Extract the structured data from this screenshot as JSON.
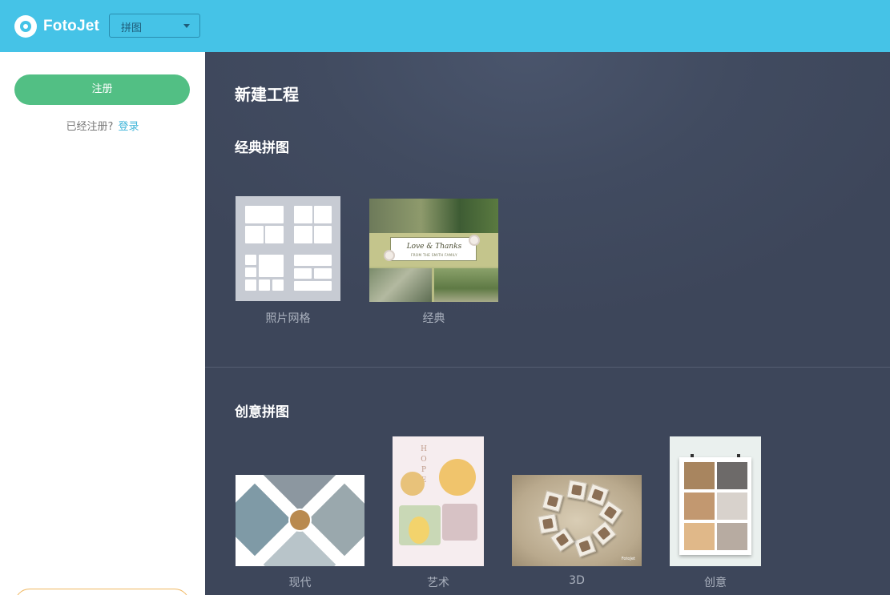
{
  "app": {
    "brand": "FotoJet",
    "mode_select": {
      "selected": "拼图"
    }
  },
  "sidebar": {
    "register_label": "注册",
    "login_hint": "已经注册?",
    "login_link": "登录"
  },
  "main": {
    "title": "新建工程",
    "sections": [
      {
        "title": "经典拼图",
        "items": [
          {
            "label": "照片网格"
          },
          {
            "label": "经典",
            "card_title": "Love & Thanks",
            "card_subtitle": "FROM THE SMITH FAMILY"
          }
        ]
      },
      {
        "title": "创意拼图",
        "items": [
          {
            "label": "现代"
          },
          {
            "label": "艺术",
            "vertical_word": "HOPE"
          },
          {
            "label": "3D",
            "brand_mark": "FotoJet"
          },
          {
            "label": "创意"
          }
        ]
      }
    ]
  },
  "colors": {
    "topbar": "#45c3e7",
    "register_button": "#52bf84",
    "link": "#3fb5d9",
    "main_background": "#3e485c"
  }
}
